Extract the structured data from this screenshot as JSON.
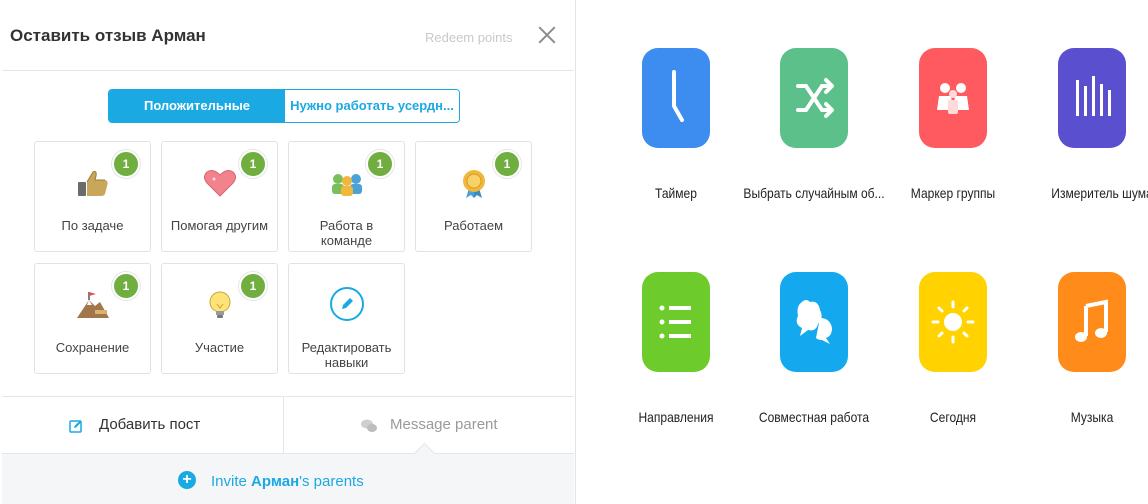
{
  "dialog": {
    "title": "Оставить отзыв Арман",
    "redeem_label": "Redeem points",
    "tabs": {
      "positive": "Положительные",
      "needs_work": "Нужно работать усердн..."
    },
    "skills": [
      {
        "label": "По задаче",
        "points": "1",
        "icon": "thumbs-up-icon"
      },
      {
        "label": "Помогая другим",
        "points": "1",
        "icon": "heart-icon"
      },
      {
        "label": "Работа в команде",
        "points": "1",
        "icon": "team-icon"
      },
      {
        "label": "Работаем",
        "points": "1",
        "icon": "medal-icon"
      },
      {
        "label": "Сохранение",
        "points": "1",
        "icon": "mountain-flag-icon"
      },
      {
        "label": "Участие",
        "points": "1",
        "icon": "lightbulb-icon"
      },
      {
        "label": "Редактировать навыки",
        "icon": "pencil-icon"
      }
    ],
    "add_post_label": "Добавить пост",
    "message_parent_label": "Message parent",
    "invite": {
      "prefix": "Invite ",
      "name": "Арман",
      "suffix": "'s parents"
    }
  },
  "tools": [
    {
      "label": "Таймер",
      "color": "#3d8cf0",
      "icon": "clock-hand-icon"
    },
    {
      "label": "Выбрать случайным об...",
      "color": "#5cc08a",
      "icon": "shuffle-icon"
    },
    {
      "label": "Маркер группы",
      "color": "#ff5a5f",
      "icon": "group-people-icon"
    },
    {
      "label": "Измеритель шума",
      "color": "#5a4fcf",
      "icon": "sound-bars-icon"
    },
    {
      "label": "Направления",
      "color": "#6dcc2b",
      "icon": "list-icon"
    },
    {
      "label": "Совместная работа",
      "color": "#14a9ee",
      "icon": "chat-bubbles-icon"
    },
    {
      "label": "Сегодня",
      "color": "#ffd200",
      "icon": "sun-icon"
    },
    {
      "label": "Музыка",
      "color": "#ff8c1a",
      "icon": "music-note-icon"
    }
  ]
}
